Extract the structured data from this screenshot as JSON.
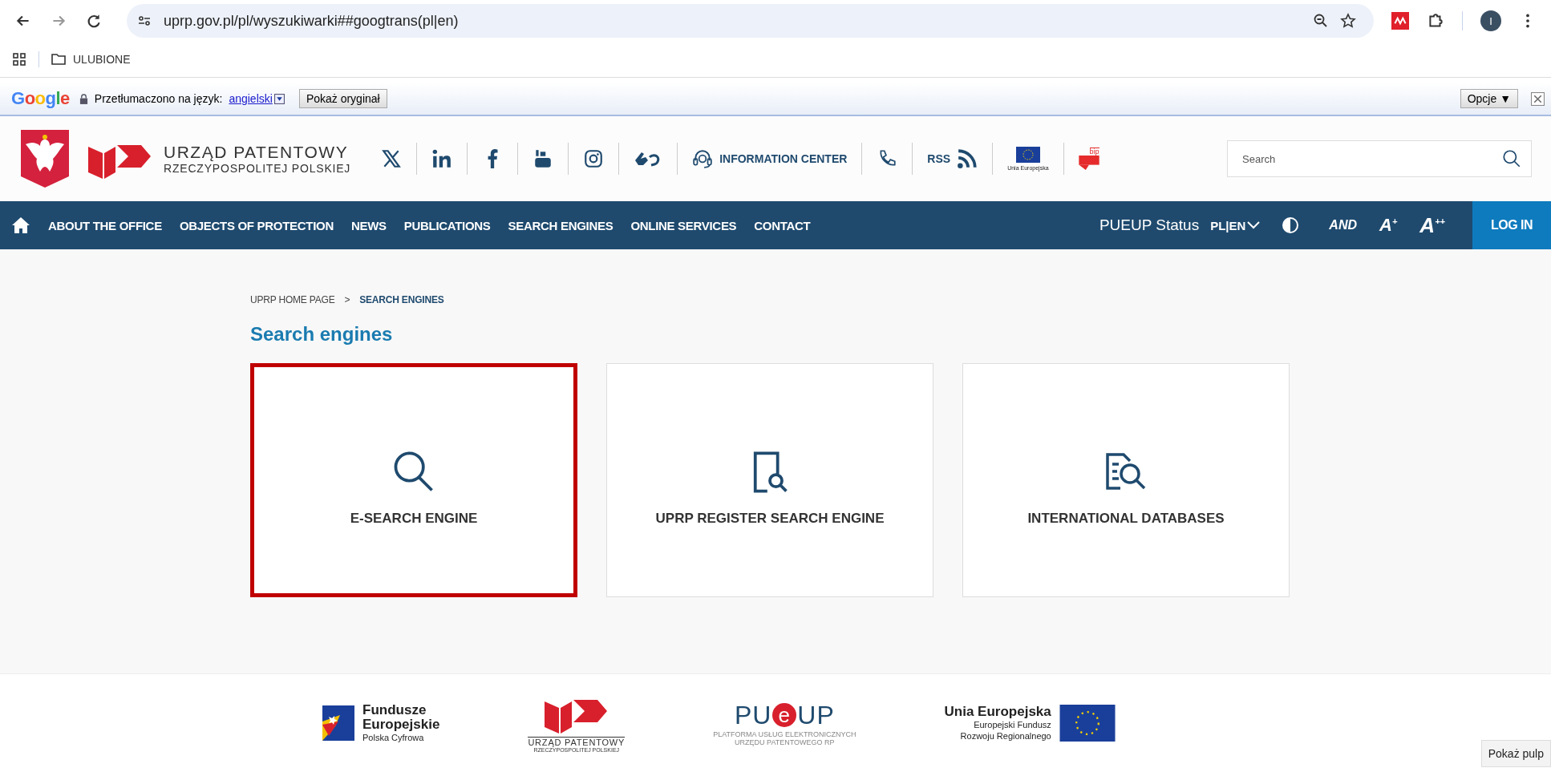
{
  "browser": {
    "url": "uprp.gov.pl/pl/wyszukiwarki##googtrans(pl|en)",
    "profile_initial": "I"
  },
  "bookmarks": [
    {
      "label": "ULUBIONE"
    }
  ],
  "translate_bar": {
    "logo": [
      {
        "text": "G",
        "color": "#4285f4"
      },
      {
        "text": "o",
        "color": "#ea4335"
      },
      {
        "text": "o",
        "color": "#fbbc05"
      },
      {
        "text": "g",
        "color": "#4285f4"
      },
      {
        "text": "l",
        "color": "#34a853"
      },
      {
        "text": "e",
        "color": "#ea4335"
      }
    ],
    "prefix": "Przetłumaczono na język:",
    "language": "angielski",
    "show_original": "Pokaż oryginał",
    "options": "Opcje ▼"
  },
  "header": {
    "title_line1": "URZĄD PATENTOWY",
    "title_line2": "RZECZYPOSPOLITEJ POLSKIEJ",
    "info_center": "INFORMATION CENTER",
    "rss": "RSS",
    "eu_label": "Unia Europejska",
    "bip": "bip",
    "search_placeholder": "Search"
  },
  "nav": {
    "items": [
      {
        "label": "ABOUT THE OFFICE"
      },
      {
        "label": "OBJECTS OF PROTECTION"
      },
      {
        "label": "NEWS"
      },
      {
        "label": "PUBLICATIONS"
      },
      {
        "label": "SEARCH ENGINES"
      },
      {
        "label": "ONLINE SERVICES"
      },
      {
        "label": "CONTACT"
      }
    ],
    "status": "PUEUP Status",
    "language": "PL|EN",
    "language_expanded": false,
    "sign_language": "AND",
    "font_larger": "A$^{+}$",
    "font_largest": "A$^{++}$",
    "login": "LOG IN"
  },
  "breadcrumb": {
    "home": "UPRP HOME PAGE",
    "separator": ">",
    "current": "SEARCH ENGINES"
  },
  "title": "Search engines",
  "cards": [
    {
      "label": "E-SEARCH ENGINE",
      "kind": "search",
      "highlighted": true
    },
    {
      "label": "UPRP REGISTER SEARCH ENGINE",
      "kind": "document",
      "highlighted": false
    },
    {
      "label": "INTERNATIONAL DATABASES",
      "kind": "database",
      "highlighted": false
    }
  ],
  "footer": {
    "funds": [
      "Fundusze",
      "Europejskie",
      "Polska Cyfrowa"
    ],
    "office": [
      "URZĄD PATENTOWY",
      "RZECZYPOSPOLITEJ POLSKIEJ"
    ],
    "pueup": {
      "left": "PU",
      "middle": "e",
      "right": "UP",
      "caption": [
        "PLATFORMA USŁUG ELEKTRONICZNYCH",
        "URZĘDU PATENTOWEGO RP"
      ]
    },
    "eu": [
      "Unia Europejska",
      "Europejski Fundusz",
      "Rozwoju Regionalnego"
    ]
  },
  "show_desktop": "Pokaż pulp"
}
